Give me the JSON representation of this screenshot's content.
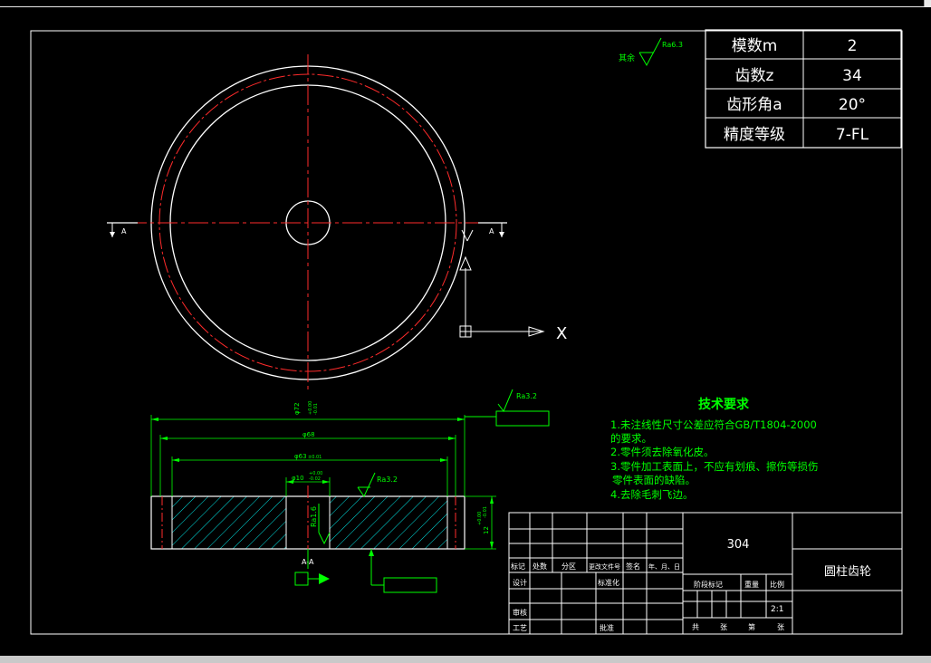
{
  "colors": {
    "background": "#000000",
    "line": "#ffffff",
    "centerline": "#ff2b2b",
    "annotation": "#00ff00",
    "dimension": "#00ff00",
    "hatch": "#00ffff",
    "marker": "#2a4cff"
  },
  "parameter_table": [
    {
      "label": "模数m",
      "value": "2"
    },
    {
      "label": "齿数z",
      "value": "34"
    },
    {
      "label": "齿形角a",
      "value": "20°"
    },
    {
      "label": "精度等级",
      "value": "7-FL"
    }
  ],
  "roughness": {
    "general_prefix": "其余",
    "general_value": "Ra6.3",
    "leader_value": "Ra3.2",
    "face_value": "Ra3.2",
    "bore_value": "Ra1.6"
  },
  "section": {
    "marker_left": "A",
    "marker_right": "A",
    "view_label": "A-A"
  },
  "axis": {
    "x_label": "X"
  },
  "dimensions": {
    "outer": "φ72",
    "outer_tol_upper": "+0.00",
    "outer_tol_lower": "-0.01",
    "middle": "φ68",
    "inner": "φ63",
    "inner_tol": "±0.01",
    "bore": "φ10",
    "bore_tol_upper": "+0.00",
    "bore_tol_lower": "-0.02",
    "width": "12",
    "width_tol_upper": "+0.00",
    "width_tol_lower": "-0.01"
  },
  "tech_notes": {
    "title": "技术要求",
    "lines": [
      "1.未注线性尺寸公差应符合GB/T1804-2000",
      "的要求。",
      "2.零件须去除氧化皮。",
      "3.零件加工表面上，不应有划痕、擦伤等损伤",
      "零件表面的缺陷。",
      "4.去除毛刺飞边。"
    ]
  },
  "title_block": {
    "material": "304",
    "part_name": "圆柱齿轮",
    "header_labels": [
      "标记",
      "处数",
      "分区",
      "更改文件号",
      "签名",
      "年、月、日"
    ],
    "design": "设计",
    "standardization": "标准化",
    "review": "审核",
    "process": "工艺",
    "approve": "批准",
    "stage_mark": "阶段标记",
    "weight": "重量",
    "scale_label": "比例",
    "scale_value": "2:1",
    "total": "共",
    "sheets": "张",
    "number": "第",
    "sheet": "张"
  }
}
